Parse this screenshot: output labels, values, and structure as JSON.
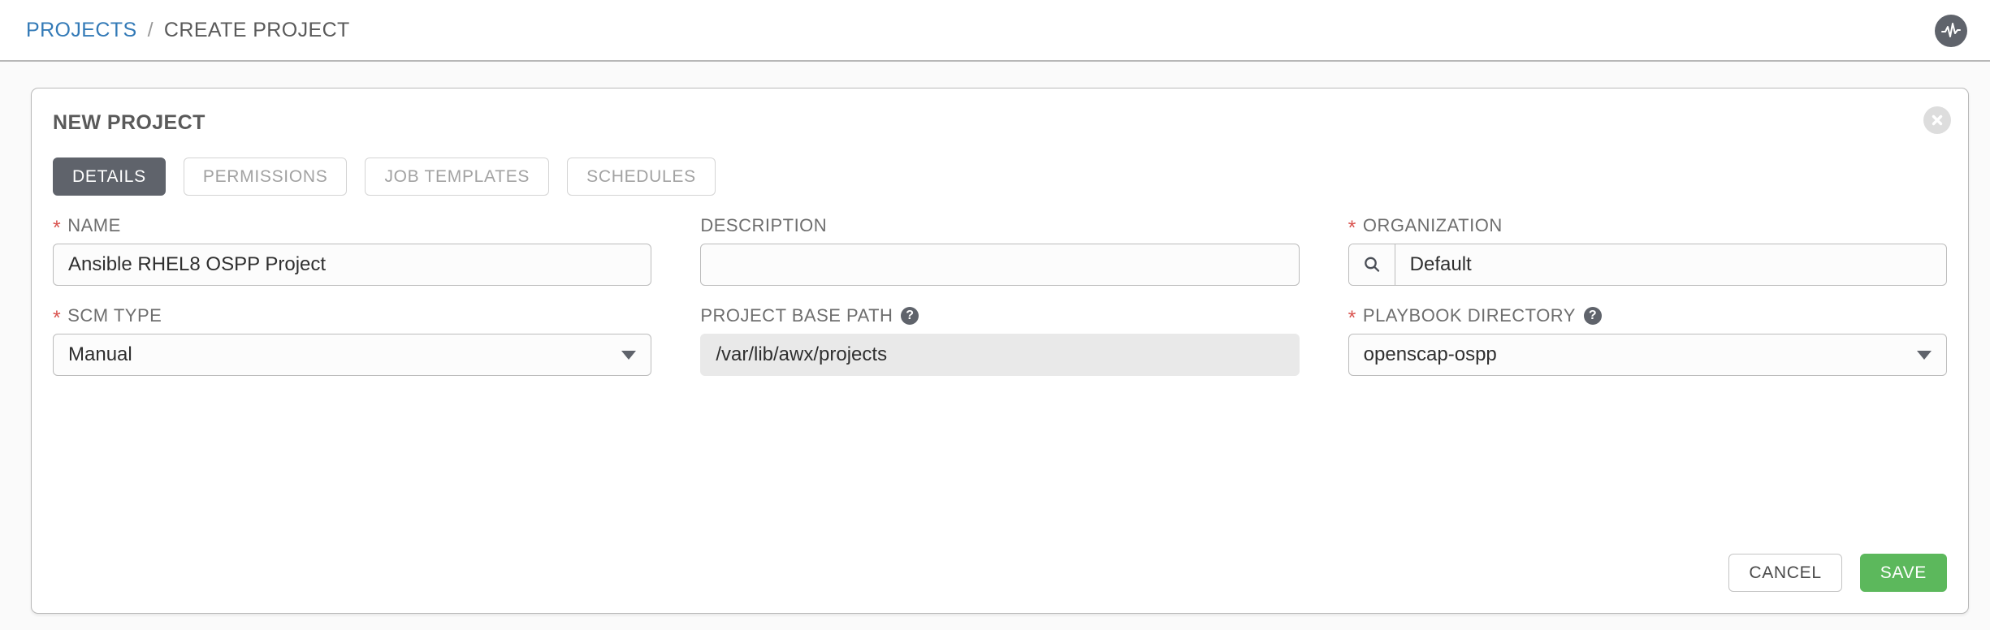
{
  "breadcrumb": {
    "root_label": "PROJECTS",
    "separator": "/",
    "current_label": "CREATE PROJECT"
  },
  "header": {
    "status_icon": "pulse-icon"
  },
  "panel": {
    "title": "NEW PROJECT",
    "close_icon": "close-circle-icon"
  },
  "tabs": [
    {
      "label": "DETAILS",
      "active": true
    },
    {
      "label": "PERMISSIONS",
      "active": false
    },
    {
      "label": "JOB TEMPLATES",
      "active": false
    },
    {
      "label": "SCHEDULES",
      "active": false
    }
  ],
  "form": {
    "name": {
      "label": "NAME",
      "required_marker": "*",
      "value": "Ansible RHEL8 OSPP Project",
      "placeholder": ""
    },
    "description": {
      "label": "DESCRIPTION",
      "value": "",
      "placeholder": ""
    },
    "organization": {
      "label": "ORGANIZATION",
      "required_marker": "*",
      "value": "Default",
      "placeholder": "",
      "search_icon": "search-icon"
    },
    "scm_type": {
      "label": "SCM TYPE",
      "required_marker": "*",
      "value": "Manual",
      "caret_icon": "chevron-down-icon"
    },
    "project_base_path": {
      "label": "PROJECT BASE PATH",
      "help_icon": "help-icon",
      "help_glyph": "?",
      "value": "/var/lib/awx/projects",
      "disabled": true
    },
    "playbook_directory": {
      "label": "PLAYBOOK DIRECTORY",
      "required_marker": "*",
      "help_icon": "help-icon",
      "help_glyph": "?",
      "value": "openscap-ospp",
      "caret_icon": "chevron-down-icon"
    }
  },
  "actions": {
    "cancel_label": "CANCEL",
    "save_label": "SAVE"
  },
  "colors": {
    "link": "#337ab7",
    "required": "#d9534f",
    "accent_dark": "#5f636b",
    "save_green": "#5cb85c"
  }
}
